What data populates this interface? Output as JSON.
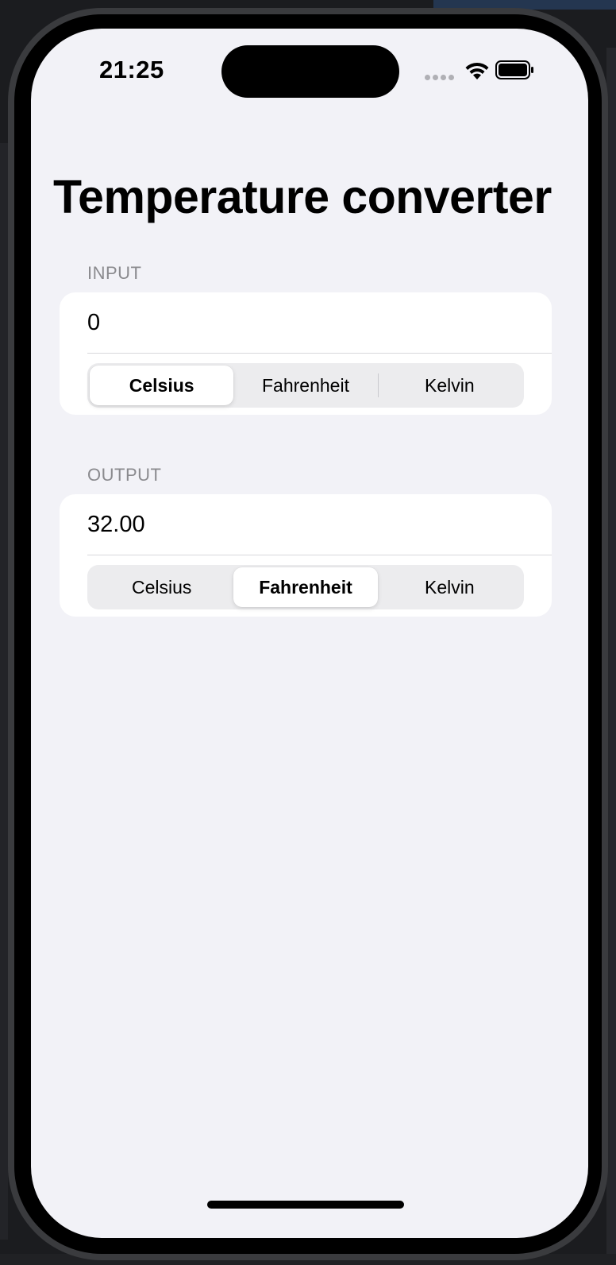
{
  "status_bar": {
    "time": "21:25"
  },
  "title": "Temperature converter",
  "input_section": {
    "header": "INPUT",
    "value": "0",
    "units": [
      "Celsius",
      "Fahrenheit",
      "Kelvin"
    ],
    "selected_unit": "Celsius"
  },
  "output_section": {
    "header": "OUTPUT",
    "value": "32.00",
    "units": [
      "Celsius",
      "Fahrenheit",
      "Kelvin"
    ],
    "selected_unit": "Fahrenheit"
  },
  "colors": {
    "background": "#f2f2f7",
    "card": "#ffffff",
    "segment_track": "#ececee",
    "section_header": "#8a8a8e"
  },
  "icons": [
    "wifi-icon",
    "battery-icon"
  ]
}
